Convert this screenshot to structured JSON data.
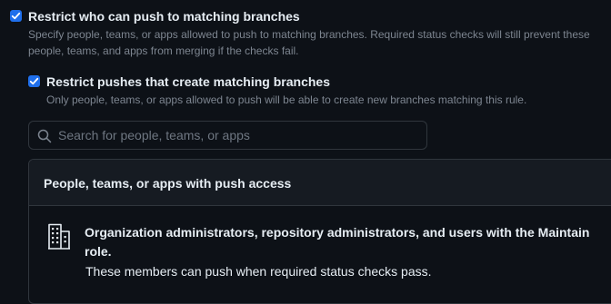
{
  "restrict_push": {
    "checked": true,
    "label": "Restrict who can push to matching branches",
    "description_line1": "Specify people, teams, or apps allowed to push to matching branches. Required status checks will still prevent these",
    "description_line2": "people, teams, and apps from merging if the checks fail."
  },
  "restrict_create": {
    "checked": true,
    "label": "Restrict pushes that create matching branches",
    "description": "Only people, teams, or apps allowed to push will be able to create new branches matching this rule."
  },
  "search": {
    "placeholder": "Search for people, teams, or apps",
    "value": "",
    "icon": "search-icon"
  },
  "push_access": {
    "header": "People, teams, or apps with push access",
    "entry": {
      "icon": "organization-icon",
      "title": "Organization administrators, repository administrators, and users with the Maintain role.",
      "description": "These members can push when required status checks pass."
    }
  },
  "colors": {
    "background": "#0d1117",
    "checkbox": "#1f6feb",
    "border": "#30363d",
    "muted_text": "#7d8590",
    "text": "#e6edf3"
  }
}
